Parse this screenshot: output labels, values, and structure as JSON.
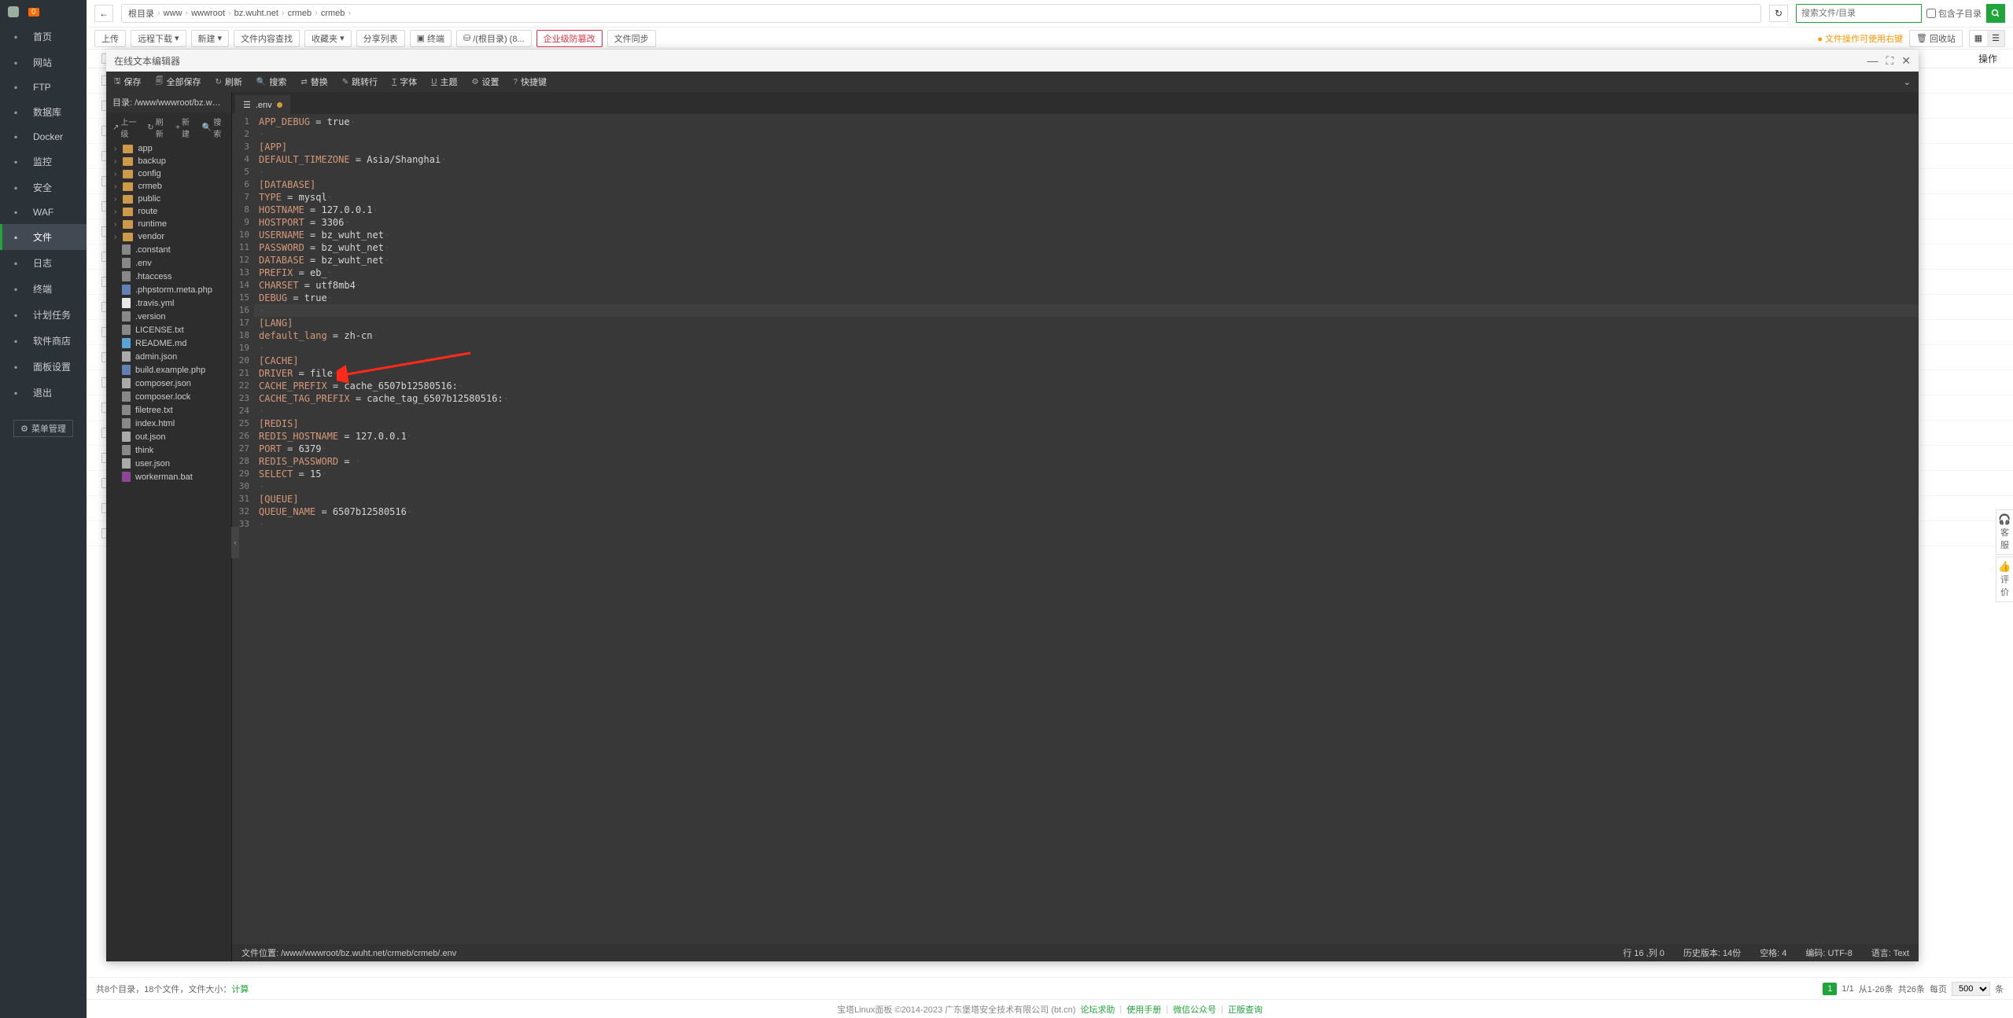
{
  "sidebar": {
    "host": "",
    "badge": "0",
    "items": [
      {
        "label": "首页",
        "icon": "home"
      },
      {
        "label": "网站",
        "icon": "globe",
        "active": true
      },
      {
        "label": "FTP",
        "icon": "ftp"
      },
      {
        "label": "数据库",
        "icon": "database"
      },
      {
        "label": "Docker",
        "icon": "docker"
      },
      {
        "label": "监控",
        "icon": "monitor"
      },
      {
        "label": "安全",
        "icon": "shield"
      },
      {
        "label": "WAF",
        "icon": "waf"
      },
      {
        "label": "文件",
        "icon": "folder",
        "activeFile": true
      },
      {
        "label": "日志",
        "icon": "log"
      },
      {
        "label": "终端",
        "icon": "terminal"
      },
      {
        "label": "计划任务",
        "icon": "clock"
      },
      {
        "label": "软件商店",
        "icon": "store"
      },
      {
        "label": "面板设置",
        "icon": "gear"
      },
      {
        "label": "退出",
        "icon": "exit"
      }
    ],
    "menuManage": "菜单管理"
  },
  "breadcrumb": {
    "parts": [
      "根目录",
      "www",
      "wwwroot",
      "bz.wuht.net",
      "crmeb",
      "crmeb"
    ]
  },
  "search": {
    "placeholder": "搜索文件/目录",
    "includeSub": "包含子目录"
  },
  "toolbar": {
    "upload": "上传",
    "remoteDownload": "远程下载",
    "new": "新建",
    "fileSearch": "文件内容查找",
    "favorites": "收藏夹",
    "shareList": "分享列表",
    "terminal": "终端",
    "rootDir": "/(根目录) (8...",
    "enterpriseTamper": "企业级防篡改",
    "fileSync": "文件同步"
  },
  "toolbarRight": {
    "warning": "文件操作可使用右键",
    "recycle": "回收站"
  },
  "fileHeader": {
    "ops": "操作"
  },
  "editor": {
    "title": "在线文本编辑器",
    "menubar": {
      "save": "保存",
      "saveAll": "全部保存",
      "refresh": "刷新",
      "search": "搜索",
      "replace": "替换",
      "goto": "跳转行",
      "font": "字体",
      "theme": "主题",
      "settings": "设置",
      "shortcut": "快捷键"
    },
    "treePath": "目录: /www/wwwroot/bz.wuht.net/crmeb/...",
    "treeToolbar": {
      "up": "上一级",
      "refresh": "刷新",
      "new": "新建",
      "search": "搜索"
    },
    "tree": {
      "folders": [
        "app",
        "backup",
        "config",
        "crmeb",
        "public",
        "route",
        "runtime",
        "vendor"
      ],
      "files": [
        {
          "name": ".constant",
          "type": "file"
        },
        {
          "name": ".env",
          "type": "file"
        },
        {
          "name": ".htaccess",
          "type": "file"
        },
        {
          "name": ".phpstorm.meta.php",
          "type": "php"
        },
        {
          "name": ".travis.yml",
          "type": "yml"
        },
        {
          "name": ".version",
          "type": "file"
        },
        {
          "name": "LICENSE.txt",
          "type": "file"
        },
        {
          "name": "README.md",
          "type": "md"
        },
        {
          "name": "admin.json",
          "type": "json"
        },
        {
          "name": "build.example.php",
          "type": "php"
        },
        {
          "name": "composer.json",
          "type": "json"
        },
        {
          "name": "composer.lock",
          "type": "file"
        },
        {
          "name": "filetree.txt",
          "type": "file"
        },
        {
          "name": "index.html",
          "type": "file"
        },
        {
          "name": "out.json",
          "type": "json"
        },
        {
          "name": "think",
          "type": "file"
        },
        {
          "name": "user.json",
          "type": "json"
        },
        {
          "name": "workerman.bat",
          "type": "bat"
        }
      ]
    },
    "tab": {
      "name": ".env"
    },
    "code": [
      "APP_DEBUG = true",
      "",
      "[APP]",
      "DEFAULT_TIMEZONE = Asia/Shanghai",
      "",
      "[DATABASE]",
      "TYPE = mysql",
      "HOSTNAME = 127.0.0.1",
      "HOSTPORT = 3306",
      "USERNAME = bz_wuht_net",
      "PASSWORD = bz_wuht_net",
      "DATABASE = bz_wuht_net",
      "PREFIX = eb_",
      "CHARSET = utf8mb4",
      "DEBUG = true",
      "",
      "[LANG]",
      "default_lang = zh-cn",
      "",
      "[CACHE]",
      "DRIVER = file",
      "CACHE_PREFIX = cache_6507b12580516:",
      "CACHE_TAG_PREFIX = cache_tag_6507b12580516:",
      "",
      "[REDIS]",
      "REDIS_HOSTNAME = 127.0.0.1",
      "PORT = 6379",
      "REDIS_PASSWORD = ",
      "SELECT = 15",
      "",
      "[QUEUE]",
      "QUEUE_NAME = 6507b12580516",
      ""
    ],
    "statusbar": {
      "filePath": "文件位置:  /www/wwwroot/bz.wuht.net/crmeb/crmeb/.env",
      "position": "行 16 ,列 0",
      "history": "历史版本:  14份",
      "spaces": "空格:  4",
      "encoding": "编码:  UTF-8",
      "language": "语言:  Text"
    }
  },
  "footer": {
    "summary": "共8个目录，18个文件，文件大小：",
    "calc": "计算",
    "page": "1",
    "pages": "1/1",
    "range": "从1-26条",
    "total": "共26条",
    "perPageLabel": "每页",
    "perPage": "500",
    "unit": "条"
  },
  "appFooter": {
    "copyright": "宝塔Linux面板 ©2014-2023 广东堡塔安全技术有限公司 (bt.cn)",
    "links": [
      "论坛求助",
      "使用手册",
      "微信公众号",
      "正版查询"
    ]
  },
  "sideTabs": {
    "service": "客服",
    "review": "评价"
  }
}
